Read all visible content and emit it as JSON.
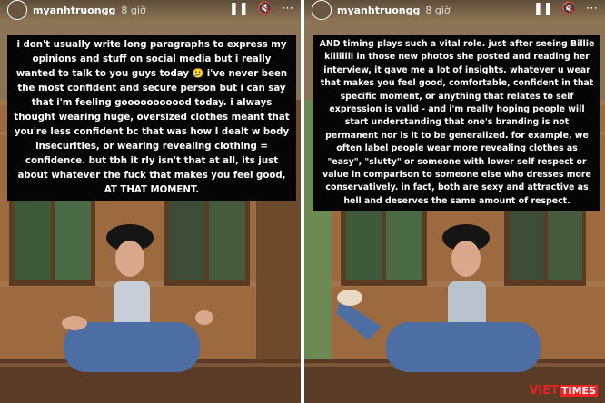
{
  "stories": [
    {
      "username": "myanhtruongg",
      "time": "8 giờ",
      "caption": "i don't usually write long paragraphs to express my opinions and stuff on social media but i really wanted to talk to you guys today 🥲 i've never been the most confident and secure person but i can say that i'm feeling gooooooooood today. i always thought wearing huge, oversized clothes meant that you're less confident bc that was how I dealt w body insecurities, or wearing revealing clothing = confidence. but tbh it rly isn't that at all, its just about whatever the fuck that makes you feel good, AT THAT MOMENT."
    },
    {
      "username": "myanhtruongg",
      "time": "8 giờ",
      "caption": "AND timing plays such a vital role. just after seeing Billie kiiiiiill in those new photos she posted and reading her interview, it gave me a lot of insights. whatever u wear that makes you feel good, comfortable, confident in that specific moment, or anything that relates to self expression is valid - and i'm really hoping people will start understanding that one's branding is not permanent nor is it to be generalized. for example, we often label people wear more revealing clothes as \"easy\", \"slutty\" or someone with lower self respect or value in comparison to someone else who dresses more conservatively. in fact, both are sexy and attractive as hell and deserves the same amount of respect."
    }
  ],
  "controls": {
    "pause": "❚❚",
    "mute": "🔇",
    "more": "⋯"
  },
  "watermark": {
    "part1": "VIET",
    "part2": "TIMES"
  },
  "colors": {
    "caption_bg": "#050505",
    "caption_text": "#ffffff",
    "watermark_red": "#e22222"
  }
}
